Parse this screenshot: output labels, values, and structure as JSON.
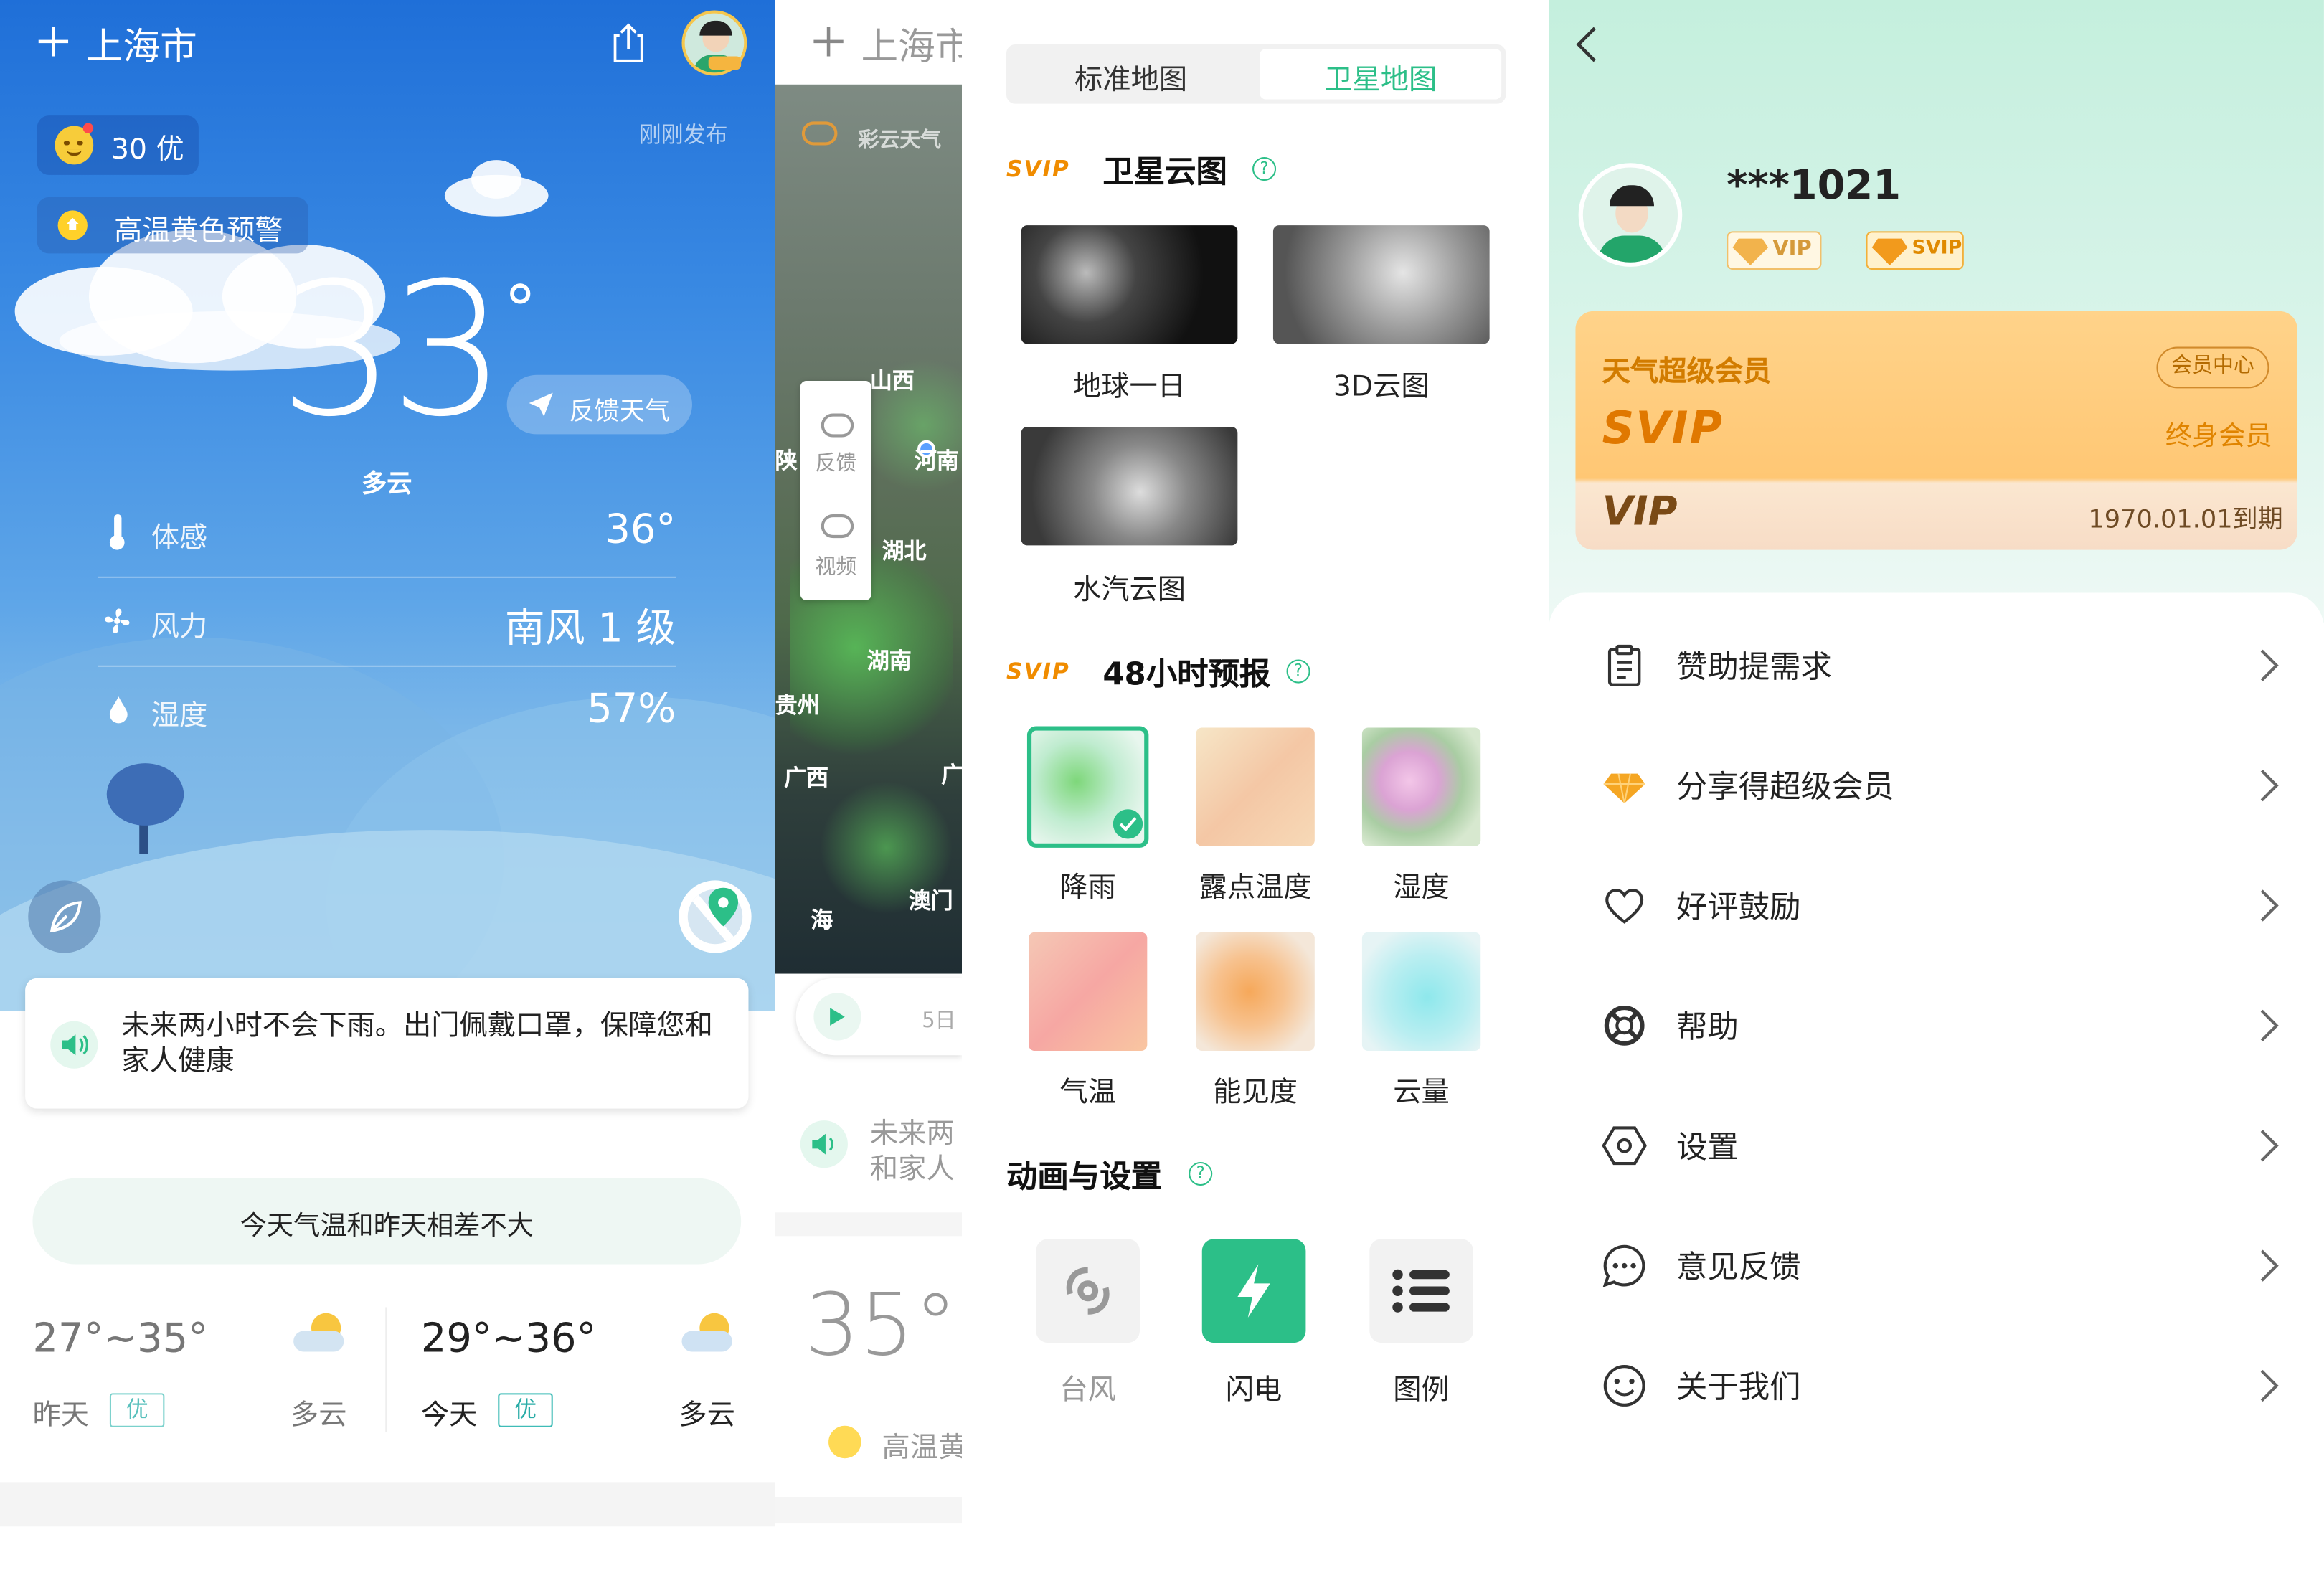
{
  "panel1": {
    "city": "上海市",
    "aqi": "30 优",
    "publish": "刚刚发布",
    "warning": "高温黄色预警",
    "temperature": "33",
    "degree": "°",
    "feedback": "反馈天气",
    "condition": "多云",
    "rows": [
      {
        "label": "体感",
        "value": "36°",
        "icon": "thermometer-icon"
      },
      {
        "label": "风力",
        "value": "南风 1 级",
        "icon": "fan-icon"
      },
      {
        "label": "湿度",
        "value": "57%",
        "icon": "droplet-icon"
      }
    ],
    "notice": "未来两小时不会下雨。出门佩戴口罩，保障您和家人健康",
    "compare": "今天气温和昨天相差不大",
    "days": [
      {
        "range": "27°~35°",
        "day": "昨天",
        "quality": "优",
        "condition": "多云"
      },
      {
        "range": "29°~36°",
        "day": "今天",
        "quality": "优",
        "condition": "多云"
      }
    ]
  },
  "panel2": {
    "city": "上海市",
    "brand": "彩云天气",
    "side_feedback": "反馈",
    "side_video": "视频",
    "provinces": [
      "山西",
      "陕",
      "河南",
      "湖北",
      "湖南",
      "贵州",
      "广西",
      "广",
      "澳门",
      "海"
    ],
    "timeline_end": "5日",
    "notice_l1": "未来两",
    "notice_l2": "和家人",
    "temp": "35°",
    "warning": "高温黄"
  },
  "panel3": {
    "tabs": [
      "标准地图",
      "卫星地图"
    ],
    "active_tab": 1,
    "svip": "SVIP",
    "section1": "卫星云图",
    "sat_items": [
      "地球一日",
      "3D云图",
      "水汽云图"
    ],
    "section2": "48小时预报",
    "forecast_items": [
      "降雨",
      "露点温度",
      "湿度",
      "气温",
      "能见度",
      "云量"
    ],
    "section3": "动画与设置",
    "settings": [
      "台风",
      "闪电",
      "图例"
    ],
    "accent": "#2cbf88"
  },
  "panel4": {
    "username": "***1021",
    "badge_vip": "VIP",
    "badge_svip": "SVIP",
    "card_title": "天气超级会员",
    "card_center": "会员中心",
    "card_svip": "SVIP",
    "card_lifetime": "终身会员",
    "card_vip": "VIP",
    "card_expire": "1970.01.01到期",
    "menu": [
      {
        "label": "赞助提需求",
        "icon": "clipboard-icon"
      },
      {
        "label": "分享得超级会员",
        "icon": "diamond-icon"
      },
      {
        "label": "好评鼓励",
        "icon": "heart-icon"
      },
      {
        "label": "帮助",
        "icon": "lifebuoy-icon"
      },
      {
        "label": "设置",
        "icon": "settings-hexagon-icon"
      },
      {
        "label": "意见反馈",
        "icon": "chat-bubble-icon"
      },
      {
        "label": "关于我们",
        "icon": "smile-icon"
      }
    ]
  }
}
